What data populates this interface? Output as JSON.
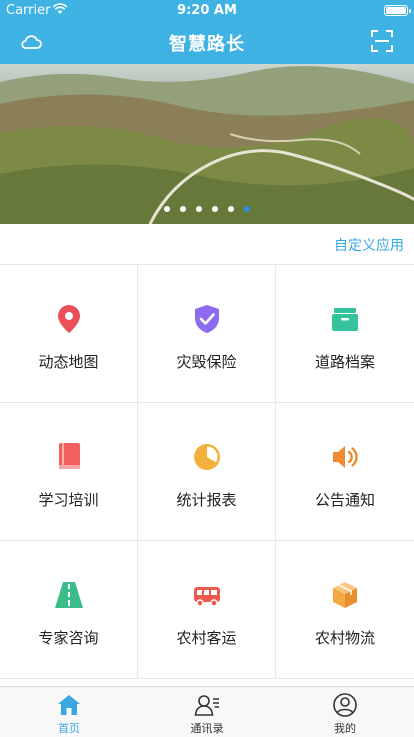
{
  "status_bar": {
    "carrier": "Carrier",
    "time": "9:20 AM"
  },
  "header": {
    "title": "智慧路长"
  },
  "banner": {
    "page_count": 6,
    "active_index": 5
  },
  "custom_link": "自定义应用",
  "grid": [
    {
      "label": "动态地图",
      "icon": "map-pin-icon",
      "color": "#e9505a"
    },
    {
      "label": "灾毁保险",
      "icon": "shield-check-icon",
      "color": "#8e6cf0"
    },
    {
      "label": "道路档案",
      "icon": "archive-box-icon",
      "color": "#34c39a"
    },
    {
      "label": "学习培训",
      "icon": "book-icon",
      "color": "#f0605e"
    },
    {
      "label": "统计报表",
      "icon": "pie-chart-icon",
      "color": "#f3b13c"
    },
    {
      "label": "公告通知",
      "icon": "speaker-icon",
      "color": "#f08a32"
    },
    {
      "label": "专家咨询",
      "icon": "road-icon",
      "color": "#3bbd8a"
    },
    {
      "label": "农村客运",
      "icon": "bus-icon",
      "color": "#ef5a4e"
    },
    {
      "label": "农村物流",
      "icon": "package-icon",
      "color": "#f5a743"
    }
  ],
  "tabs": [
    {
      "label": "首页",
      "icon": "home-icon",
      "active": true
    },
    {
      "label": "通讯录",
      "icon": "contacts-icon",
      "active": false
    },
    {
      "label": "我的",
      "icon": "profile-icon",
      "active": false
    }
  ],
  "colors": {
    "brand": "#3db2e3",
    "accent": "#3aa7e0"
  }
}
